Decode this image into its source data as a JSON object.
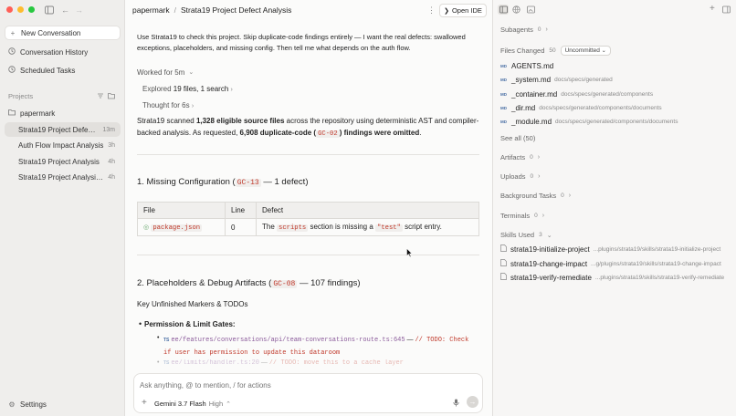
{
  "sidebar": {
    "new_conversation": "New Conversation",
    "history": "Conversation History",
    "scheduled": "Scheduled Tasks",
    "projects_label": "Projects",
    "project_name": "papermark",
    "items": [
      {
        "title": "Strata19 Project Defect ...",
        "ago": "13m"
      },
      {
        "title": "Auth Flow Impact Analysis",
        "ago": "3h"
      },
      {
        "title": "Strata19 Project Analysis",
        "ago": "4h"
      },
      {
        "title": "Strata19 Project Analysis ...",
        "ago": "4h"
      }
    ],
    "settings": "Settings"
  },
  "header": {
    "breadcrumb_root": "papermark",
    "sep": "/",
    "title": "Strata19 Project Defect Analysis",
    "open_ide": "Open IDE"
  },
  "conversation": {
    "user_message": "Use Strata19 to check this project. Skip duplicate-code findings entirely — I want the real defects: swallowed exceptions, placeholders, and missing config. Then tell me what depends on the auth flow.",
    "worked_for": "Worked for 5m",
    "explored_a": "Explored ",
    "explored_b": "19 files, 1 search",
    "thought": "Thought for 6s",
    "summary": {
      "a": "Strata19 scanned ",
      "b": "1,328 eligible source files",
      "c": " across the repository using deterministic AST and compiler-backed analysis. As requested, ",
      "d": "6,908 duplicate-code (",
      "e": "GC-02",
      "f": ") findings were omitted",
      "g": "."
    },
    "section1": {
      "a": "1. Missing Configuration (",
      "code": "GC-13",
      "b": " — 1 defect)"
    },
    "table": {
      "headers": [
        "File",
        "Line",
        "Defect"
      ],
      "row": {
        "file": "package.json",
        "line": "0",
        "d1": "The ",
        "code1": "scripts",
        "d2": " section is missing a ",
        "code2": "\"test\"",
        "d3": " script entry."
      }
    },
    "section2": {
      "a": "2. Placeholders & Debug Artifacts (",
      "code": "GC-08",
      "b": " — 107 findings)"
    },
    "markers_heading": "Key Unfinished Markers & TODOs",
    "bullet": "Permission & Limit Gates:",
    "sub1": {
      "badge": "TS",
      "path": "ee/features/conversations/api/team-conversations-route.ts:645",
      "dash": " — ",
      "comment": "// TODO: Check if user has permission to update this dataroom"
    },
    "sub2": {
      "badge": "TS",
      "path": "ee/limits/handler.ts:20",
      "dash": " — ",
      "comment": "// TODO: move this to a cache layer"
    }
  },
  "composer": {
    "placeholder": "Ask anything, @ to mention, / for actions",
    "model": "Gemini 3.7 Flash",
    "effort": "High"
  },
  "right": {
    "subagents": {
      "label": "Subagents",
      "count": "0"
    },
    "files_changed": {
      "label": "Files Changed",
      "count": "50",
      "filter": "Uncommitted"
    },
    "files": [
      {
        "name": "AGENTS.md",
        "path": ""
      },
      {
        "name": "_system.md",
        "path": "docs/specs/generated"
      },
      {
        "name": "_container.md",
        "path": "docs/specs/generated/components"
      },
      {
        "name": "_dir.md",
        "path": "docs/specs/generated/components/documents"
      },
      {
        "name": "_module.md",
        "path": "docs/specs/generated/components/documents"
      }
    ],
    "file_badge": "MD",
    "see_all": "See all (50)",
    "artifacts": {
      "label": "Artifacts",
      "count": "0"
    },
    "uploads": {
      "label": "Uploads",
      "count": "0"
    },
    "background": {
      "label": "Background Tasks",
      "count": "0"
    },
    "terminals": {
      "label": "Terminals",
      "count": "0"
    },
    "skills": {
      "label": "Skills Used",
      "count": "3"
    },
    "skill_items": [
      {
        "name": "strata19-initialize-project",
        "path": "...plugins/strata19/skills/strata19-initialize-project"
      },
      {
        "name": "strata19-change-impact",
        "path": "...g/plugins/strata19/skills/strata19-change-impact"
      },
      {
        "name": "strata19-verify-remediate",
        "path": "...plugins/strata19/skills/strata19-verify-remediate"
      }
    ]
  },
  "colors": {
    "accent": "#c0392b",
    "close": "#ff5f57",
    "minimize": "#febc2e",
    "zoom": "#28c840"
  }
}
